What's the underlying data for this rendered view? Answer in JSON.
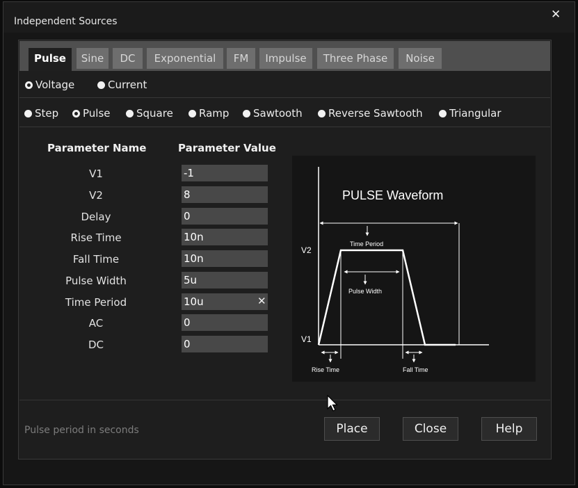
{
  "window": {
    "title": "Independent Sources",
    "close_icon": "close-icon"
  },
  "tabs": [
    {
      "label": "Pulse",
      "active": true
    },
    {
      "label": "Sine"
    },
    {
      "label": "DC"
    },
    {
      "label": "Exponential"
    },
    {
      "label": "FM"
    },
    {
      "label": "Impulse"
    },
    {
      "label": "Three Phase"
    },
    {
      "label": "Noise"
    }
  ],
  "source_type": {
    "options": [
      "Voltage",
      "Current"
    ],
    "selected": "Voltage"
  },
  "waveform_type": {
    "options": [
      "Step",
      "Pulse",
      "Square",
      "Ramp",
      "Sawtooth",
      "Reverse Sawtooth",
      "Triangular"
    ],
    "selected": "Pulse"
  },
  "params": {
    "header_name": "Parameter Name",
    "header_value": "Parameter Value",
    "rows": [
      {
        "name": "V1",
        "value": "-1"
      },
      {
        "name": "V2",
        "value": "8"
      },
      {
        "name": "Delay",
        "value": "0"
      },
      {
        "name": "Rise Time",
        "value": "10n"
      },
      {
        "name": "Fall Time",
        "value": "10n"
      },
      {
        "name": "Pulse Width",
        "value": "5u"
      },
      {
        "name": "Time Period",
        "value": "10u",
        "focused": true
      },
      {
        "name": "AC",
        "value": "0"
      },
      {
        "name": "DC",
        "value": "0"
      }
    ]
  },
  "diagram": {
    "title": "PULSE Waveform",
    "label_v2": "V2",
    "label_v1": "V1",
    "label_time_period": "Time Period",
    "label_pulse_width": "Pulse Width",
    "label_rise_time": "Rise Time",
    "label_fall_time": "Fall Time"
  },
  "footer": {
    "status": "Pulse period in seconds",
    "place_label": "Place",
    "close_label": "Close",
    "help_label": "Help"
  },
  "colors": {
    "background": "#161616",
    "tab_inactive": "#6e6e6e",
    "input": "#484848",
    "accent": "#ffffff"
  }
}
